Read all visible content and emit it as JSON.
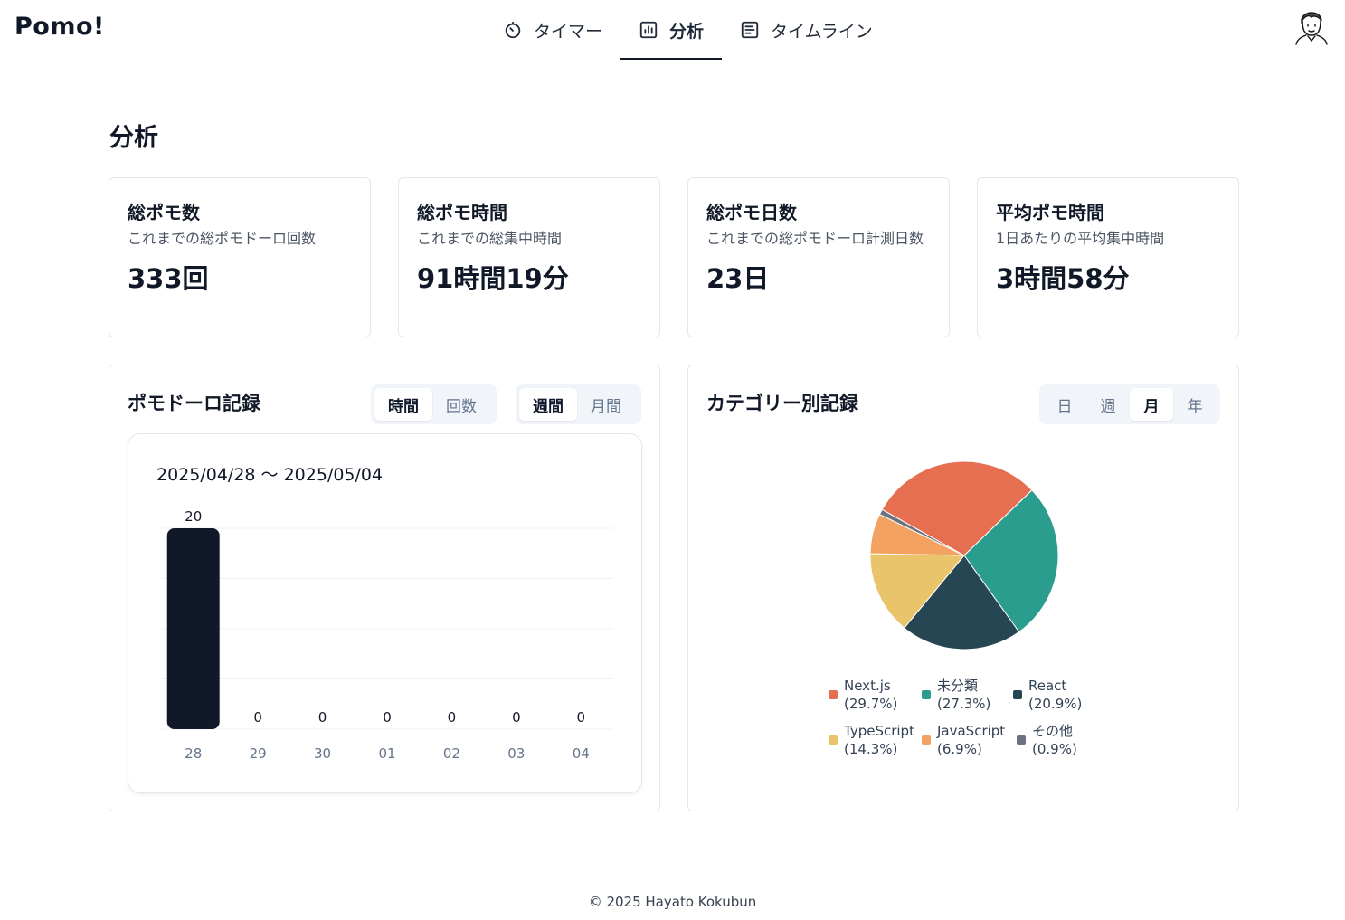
{
  "app": {
    "logo": "Pomo!"
  },
  "nav": {
    "items": [
      {
        "label": "タイマー",
        "icon": "timer-icon"
      },
      {
        "label": "分析",
        "icon": "chart-icon",
        "active": true
      },
      {
        "label": "タイムライン",
        "icon": "list-icon"
      }
    ]
  },
  "page": {
    "title": "分析"
  },
  "stats": [
    {
      "title": "総ポモ数",
      "desc": "これまでの総ポモドーロ回数",
      "value": "333回"
    },
    {
      "title": "総ポモ時間",
      "desc": "これまでの総集中時間",
      "value": "91時間19分"
    },
    {
      "title": "総ポモ日数",
      "desc": "これまでの総ポモドーロ計測日数",
      "value": "23日"
    },
    {
      "title": "平均ポモ時間",
      "desc": "1日あたりの平均集中時間",
      "value": "3時間58分"
    }
  ],
  "records": {
    "title": "ポモドーロ記録",
    "metric_toggle": {
      "options": [
        "時間",
        "回数"
      ],
      "selected": "時間"
    },
    "period_toggle": {
      "options": [
        "週間",
        "月間"
      ],
      "selected": "週間"
    },
    "range": "2025/04/28 〜 2025/05/04"
  },
  "category": {
    "title": "カテゴリー別記録",
    "period_toggle": {
      "options": [
        "日",
        "週",
        "月",
        "年"
      ],
      "selected": "月"
    }
  },
  "chart_data": [
    {
      "type": "bar",
      "categories": [
        "28",
        "29",
        "30",
        "01",
        "02",
        "03",
        "04"
      ],
      "values": [
        20,
        0,
        0,
        0,
        0,
        0,
        0
      ],
      "ylim": [
        0,
        20
      ],
      "grid": true,
      "color": "#111827"
    },
    {
      "type": "pie",
      "legend_position": "bottom",
      "slices": [
        {
          "label": "Next.js",
          "percent_label": "(29.7%)",
          "value": 29.7,
          "color": "#e76f51"
        },
        {
          "label": "未分類",
          "percent_label": "(27.3%)",
          "value": 27.3,
          "color": "#2a9d8f"
        },
        {
          "label": "React",
          "percent_label": "(20.9%)",
          "value": 20.9,
          "color": "#264653"
        },
        {
          "label": "TypeScript",
          "percent_label": "(14.3%)",
          "value": 14.3,
          "color": "#e9c46a"
        },
        {
          "label": "JavaScript",
          "percent_label": "(6.9%)",
          "value": 6.9,
          "color": "#f4a261"
        },
        {
          "label": "その他",
          "percent_label": "(0.9%)",
          "value": 0.9,
          "color": "#6b7280"
        }
      ]
    }
  ],
  "footer": {
    "text": "© 2025 Hayato Kokubun"
  }
}
